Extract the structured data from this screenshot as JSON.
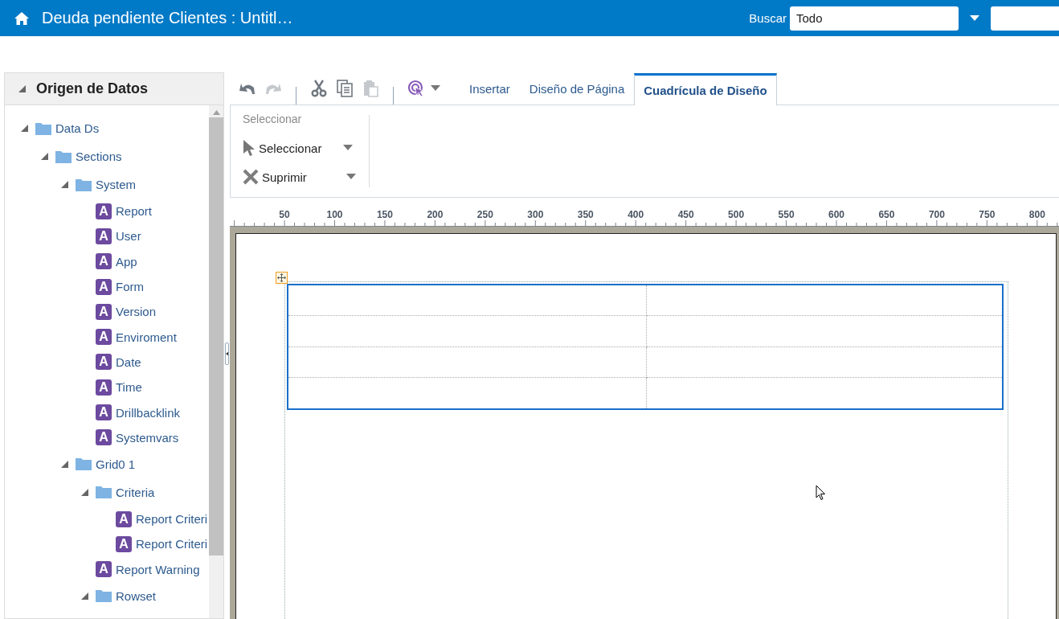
{
  "header": {
    "title": "Deuda pendiente Clientes : Untitl…",
    "search_label": "Buscar",
    "search_scope": "Todo"
  },
  "data_source": {
    "title": "Origen de Datos",
    "expanded": true,
    "items": [
      {
        "kind": "folder",
        "label": "Data Ds",
        "expanded": true,
        "children": [
          {
            "kind": "folder",
            "label": "Sections",
            "expanded": true,
            "children": [
              {
                "kind": "folder",
                "label": "System",
                "expanded": true,
                "children": [
                  {
                    "kind": "field",
                    "badge": "A",
                    "label": "Report"
                  },
                  {
                    "kind": "field",
                    "badge": "A",
                    "label": "User"
                  },
                  {
                    "kind": "field",
                    "badge": "A",
                    "label": "App"
                  },
                  {
                    "kind": "field",
                    "badge": "A",
                    "label": "Form"
                  },
                  {
                    "kind": "field",
                    "badge": "A",
                    "label": "Version"
                  },
                  {
                    "kind": "field",
                    "badge": "A",
                    "label": "Enviroment"
                  },
                  {
                    "kind": "field",
                    "badge": "A",
                    "label": "Date"
                  },
                  {
                    "kind": "field",
                    "badge": "A",
                    "label": "Time"
                  },
                  {
                    "kind": "field",
                    "badge": "A",
                    "label": "Drillbacklink"
                  },
                  {
                    "kind": "field",
                    "badge": "A",
                    "label": "Systemvars"
                  }
                ]
              },
              {
                "kind": "folder",
                "label": "Grid0 1",
                "expanded": true,
                "children": [
                  {
                    "kind": "folder",
                    "label": "Criteria",
                    "expanded": true,
                    "children": [
                      {
                        "kind": "field",
                        "badge": "A",
                        "label": "Report Criteri"
                      },
                      {
                        "kind": "field",
                        "badge": "A",
                        "label": "Report Criteri"
                      }
                    ]
                  },
                  {
                    "kind": "field",
                    "badge": "A",
                    "label": "Report Warning"
                  },
                  {
                    "kind": "folder",
                    "label": "Rowset",
                    "expanded": true
                  }
                ]
              }
            ]
          }
        ]
      }
    ]
  },
  "toolbar": {
    "groups": [
      {
        "buttons": [
          {
            "kind": "undo",
            "disabled": false
          },
          {
            "kind": "redo",
            "disabled": true
          }
        ]
      },
      {
        "buttons": [
          {
            "kind": "cut",
            "disabled": false
          },
          {
            "kind": "copy",
            "disabled": false
          },
          {
            "kind": "paste",
            "disabled": true
          }
        ]
      },
      {
        "buttons": [
          {
            "kind": "target",
            "disabled": false,
            "menu": true
          }
        ]
      }
    ]
  },
  "tabs": [
    {
      "label": "Insertar",
      "selected": false
    },
    {
      "label": "Diseño de Página",
      "selected": false
    },
    {
      "label": "Cuadrícula de Diseño",
      "selected": true
    }
  ],
  "ribbon": {
    "group_label": "Seleccionar",
    "commands": [
      {
        "kind": "select",
        "label": "Seleccionar"
      },
      {
        "kind": "delete",
        "label": "Suprimir"
      }
    ]
  },
  "ruler": {
    "labels": [
      "50",
      "100",
      "150",
      "200",
      "250",
      "300",
      "350",
      "400",
      "450",
      "500",
      "550",
      "600",
      "650",
      "700",
      "750",
      "800"
    ]
  },
  "design_grid": {
    "selected": true
  }
}
